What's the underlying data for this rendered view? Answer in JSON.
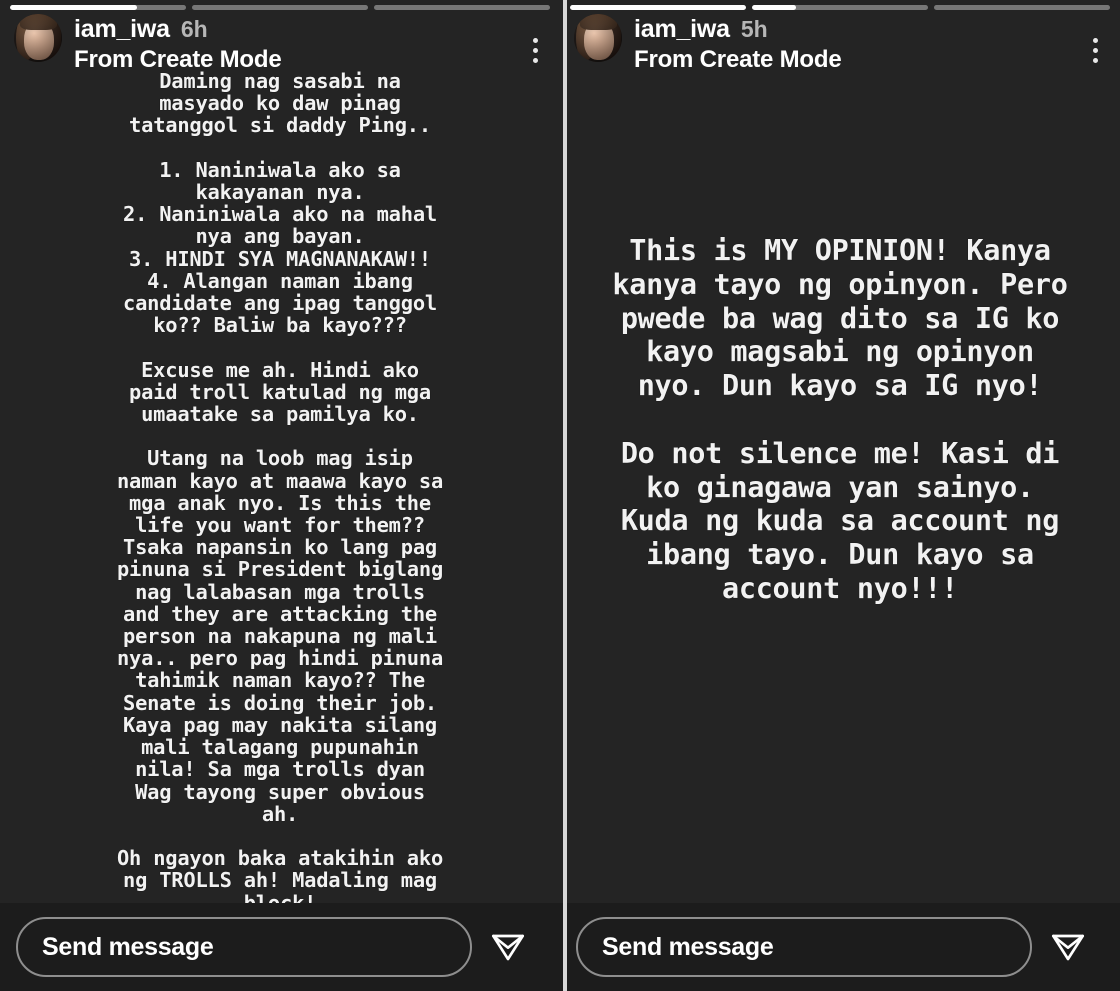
{
  "app": {
    "name": "Instagram Stories",
    "background_color": "#242424",
    "accent_color": "#ffffff"
  },
  "stories": [
    {
      "id": "story-left",
      "progress": {
        "segments": 3,
        "active_index": 0,
        "active_percent": 72
      },
      "header": {
        "avatar_label": "iam_iwa profile photo",
        "username": "iam_iwa",
        "timestamp": "6h",
        "subtitle": "From Create Mode",
        "menu_label": "More options"
      },
      "body_text": "Daming nag sasabi na\nmasyado ko daw pinag\ntatanggol si daddy Ping..\n\n1. Naniniwala ako sa\nkakayanan nya.\n2. Naniniwala ako na mahal\nnya ang bayan.\n3. HINDI SYA MAGNANAKAW!!\n4. Alangan naman ibang\ncandidate ang ipag tanggol\nko?? Baliw ba kayo???\n\nExcuse me ah. Hindi ako\npaid troll katulad ng mga\numaatake sa pamilya ko.\n\nUtang na loob mag isip\nnaman kayo at maawa kayo sa\nmga anak nyo. Is this the\nlife you want for them??\nTsaka napansin ko lang pag\npinuna si President biglang\nnag lalabasan mga trolls\nand they are attacking the\nperson na nakapuna ng mali\nnya.. pero pag hindi pinuna\ntahimik naman kayo?? The\nSenate is doing their job.\nKaya pag may nakita silang\nmali talagang pupunahin\nnila! Sa mga trolls dyan\nWag tayong super obvious\nah.\n\nOh ngayon baka atakihin ako\nng TROLLS ah! Madaling mag\nblock!",
      "footer": {
        "send_placeholder": "Send message",
        "send_icon_label": "paper-plane-icon"
      }
    },
    {
      "id": "story-right",
      "progress": {
        "segments": 3,
        "active_index": 1,
        "active_percent": 25
      },
      "header": {
        "avatar_label": "iam_iwa profile photo",
        "username": "iam_iwa",
        "timestamp": "5h",
        "subtitle": "From Create Mode",
        "menu_label": "More options"
      },
      "body_text": "This is MY OPINION! Kanya\nkanya tayo ng opinyon. Pero\npwede ba wag dito sa IG ko\nkayo magsabi ng opinyon\nnyo. Dun kayo sa IG nyo!\n\nDo not silence me! Kasi di\nko ginagawa yan sainyo.\nKuda ng kuda sa account ng\nibang tayo. Dun kayo sa\naccount nyo!!!",
      "footer": {
        "send_placeholder": "Send message",
        "send_icon_label": "paper-plane-icon"
      }
    }
  ]
}
